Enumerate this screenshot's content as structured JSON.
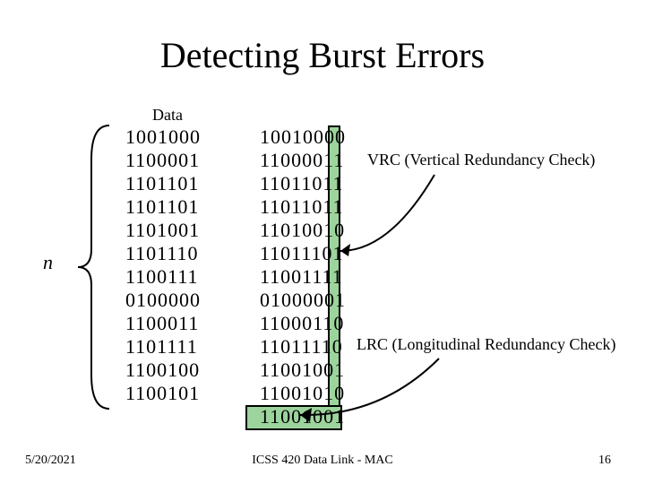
{
  "title": "Detecting Burst Errors",
  "data_label": "Data",
  "n_label": "n",
  "data_col": [
    "1001000",
    "1100001",
    "1101101",
    "1101101",
    "1101001",
    "1101110",
    "1100111",
    "0100000",
    "1100011",
    "1101111",
    "1100100",
    "1100101"
  ],
  "encoded_col": [
    "10010000",
    "11000011",
    "11011011",
    "11011011",
    "11010010",
    "11011101",
    "11001111",
    "01000001",
    "11000110",
    "11011110",
    "11001001",
    "11001010",
    "11001001"
  ],
  "vrc_label": "VRC (Vertical Redundancy Check)",
  "lrc_label": "LRC (Longitudinal Redundancy Check)",
  "footer": {
    "date": "5/20/2021",
    "center": "ICSS 420 Data Link - MAC",
    "page": "16"
  }
}
